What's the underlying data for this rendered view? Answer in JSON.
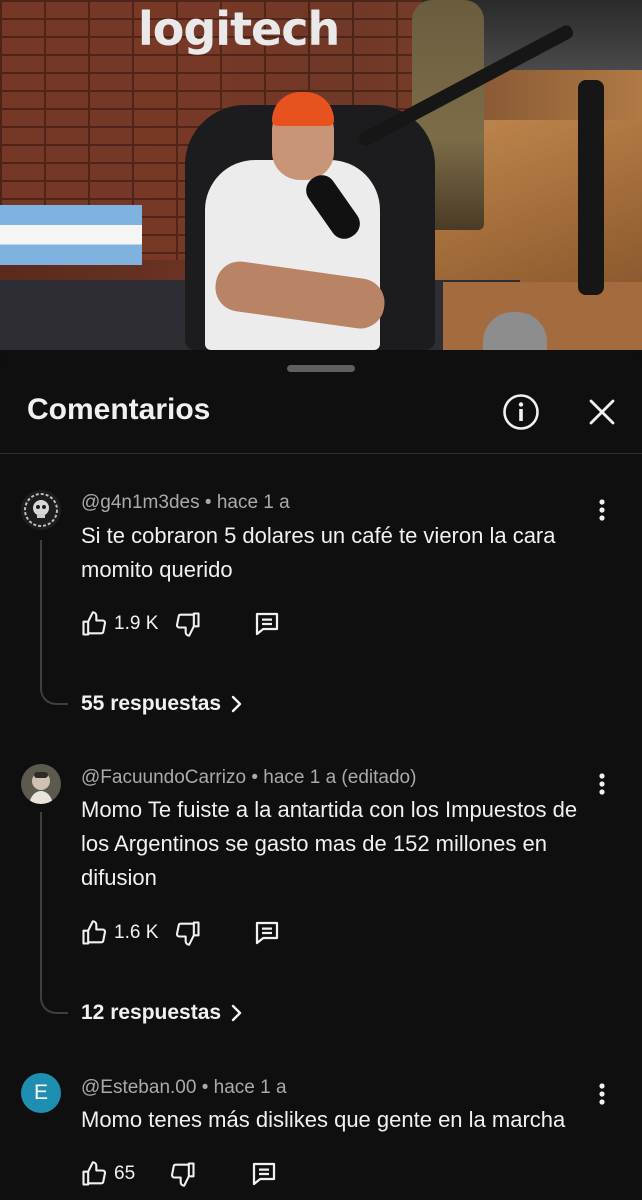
{
  "video": {
    "logo_text": "logitech"
  },
  "panel": {
    "title": "Comentarios",
    "info_icon": "info-icon",
    "close_icon": "close-icon"
  },
  "colors": {
    "background": "#0f0f0f",
    "text_primary": "#f1f1f1",
    "text_secondary": "#aaaaaa",
    "avatar_e": "#1e8fb0"
  },
  "comments": [
    {
      "author": "@g4n1m3des",
      "time": "hace 1 a",
      "text": "Si te cobraron 5 dolares un café te vieron la cara momito querido",
      "likes": "1.9 K",
      "replies": "55 respuestas"
    },
    {
      "author": "@FacuundoCarrizo",
      "time": "hace 1 a (editado)",
      "text": "Momo Te fuiste a la antartida con los Impuestos de los Argentinos se gasto mas de 152 millones en difusion",
      "likes": "1.6 K",
      "replies": "12 respuestas"
    },
    {
      "author": "@Esteban.00",
      "time": "hace 1 a",
      "avatar_letter": "E",
      "text": "Momo tenes más dislikes que gente en la marcha",
      "likes": "65"
    }
  ]
}
